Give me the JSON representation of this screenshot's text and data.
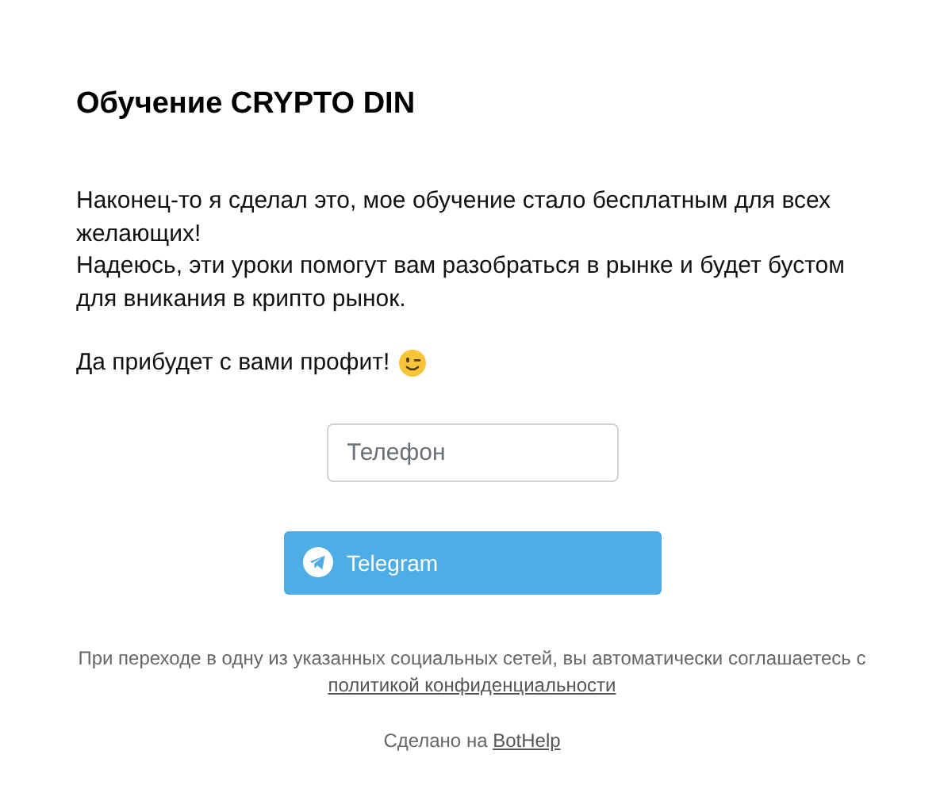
{
  "title": "Обучение CRYPTO DIN",
  "paragraphs": [
    "Наконец-то я сделал это, мое обучение стало бесплатным для всех желающих!",
    "Надеюсь, эти уроки помогут вам разобраться в рынке и будет бустом для вникания в крипто рынок.",
    "Да прибудет с вами профит!"
  ],
  "phone_field": {
    "placeholder": "Телефон"
  },
  "buttons": [
    {
      "kind": "telegram",
      "label": "Telegram"
    }
  ],
  "legal": {
    "text": "При переходе в одну из указанных социальных сетей, вы автоматически соглашаетесь с",
    "link": "политикой конфиденциальности"
  },
  "footer": {
    "text": "Сделано на",
    "link": "BotHelp"
  }
}
